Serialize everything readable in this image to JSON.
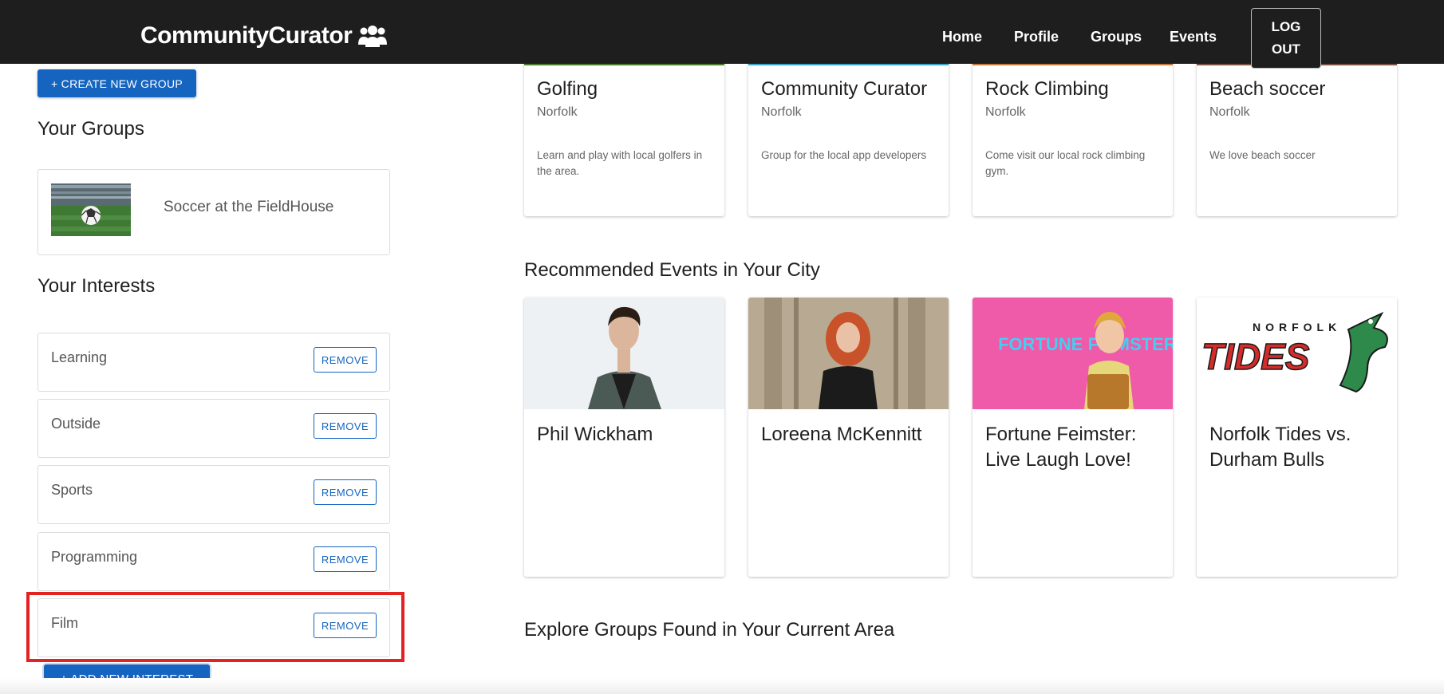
{
  "navbar": {
    "brand": "CommunityCurator",
    "brand_icon": "users-icon",
    "links": [
      "Home",
      "Profile",
      "Groups",
      "Events"
    ],
    "logout_line1": "LOG",
    "logout_line2": "OUT"
  },
  "sidebar": {
    "create_group_label": "+ CREATE NEW GROUP",
    "your_groups_title": "Your Groups",
    "groups": [
      {
        "name": "Soccer at the FieldHouse"
      }
    ],
    "your_interests_title": "Your Interests",
    "interests": [
      {
        "label": "Learning",
        "action": "REMOVE"
      },
      {
        "label": "Outside",
        "action": "REMOVE"
      },
      {
        "label": "Sports",
        "action": "REMOVE"
      },
      {
        "label": "Programming",
        "action": "REMOVE"
      },
      {
        "label": "Film",
        "action": "REMOVE"
      }
    ],
    "add_interest_label": "+ ADD NEW INTEREST"
  },
  "main": {
    "groups": [
      {
        "title": "Golfing",
        "city": "Norfolk",
        "description": "Learn and play with local golfers in the area.",
        "color": "#4a7a2c"
      },
      {
        "title": "Community Curator",
        "city": "Norfolk",
        "description": "Group for the local app developers",
        "color": "#3aa6c9"
      },
      {
        "title": "Rock Climbing",
        "city": "Norfolk",
        "description": "Come visit our local rock climbing gym.",
        "color": "#c7793b"
      },
      {
        "title": "Beach soccer",
        "city": "Norfolk",
        "description": "We love beach soccer",
        "color": "#7a5040"
      }
    ],
    "recommended_events_title": "Recommended Events in Your City",
    "events": [
      {
        "title": "Phil Wickham"
      },
      {
        "title": "Loreena McKennitt"
      },
      {
        "title": "Fortune Feimster: Live Laugh Love!",
        "poster_text": "FORTUNE FEIMSTER"
      },
      {
        "title": "Norfolk Tides vs. Durham Bulls",
        "logo_top": "NORFOLK",
        "logo_main": "TIDES"
      }
    ],
    "explore_title": "Explore Groups Found in Your Current Area"
  },
  "colors": {
    "navbar_bg": "#1e1e1e",
    "primary": "#1565c0",
    "highlight": "#e42222"
  }
}
